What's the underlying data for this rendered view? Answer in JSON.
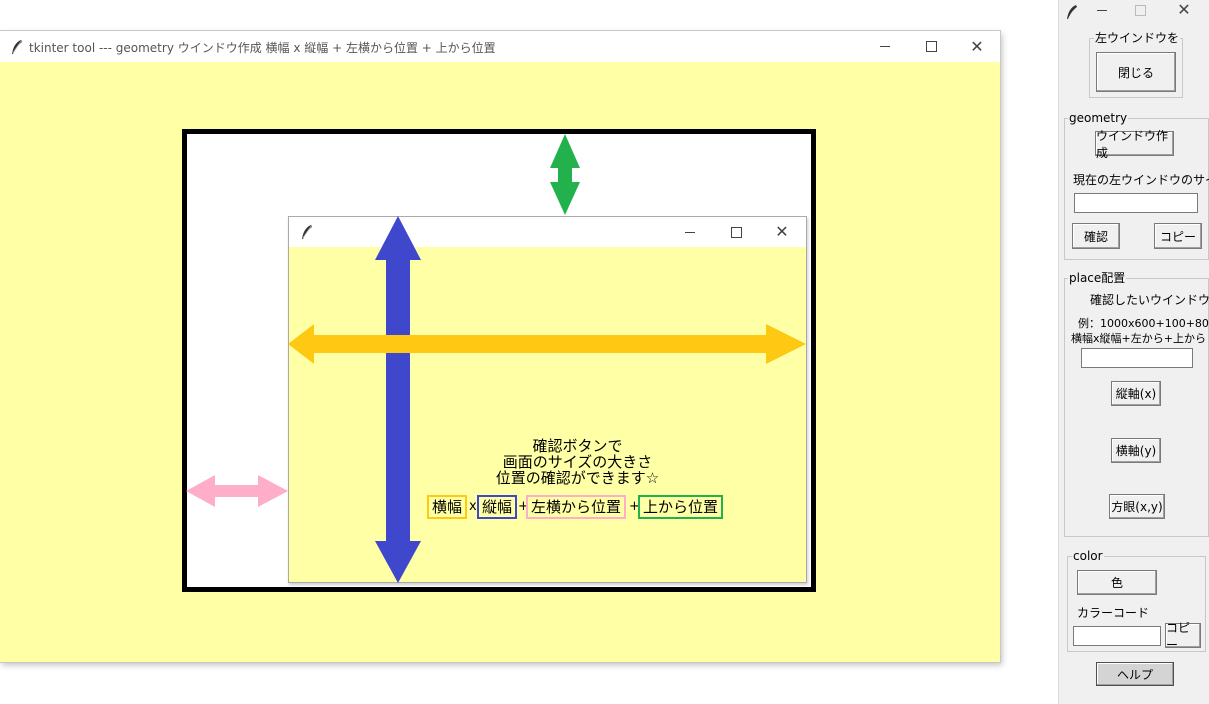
{
  "main_window": {
    "title": "tkinter tool  --- geometry  ウインドウ作成   横幅 x 縦幅 + 左横から位置 + 上から位置"
  },
  "diagram": {
    "explain_lines": [
      "確認ボタンで",
      "画面のサイズの大きさ",
      "位置の確認ができます☆"
    ],
    "legend": {
      "width": "横幅",
      "x_sep": "x",
      "height": "縦幅",
      "plus1": "+",
      "left": "左横から位置",
      "plus2": "+",
      "top": "上から位置"
    },
    "colors": {
      "width_arrow": "#ffc913",
      "height_arrow": "#3f48cc",
      "left_arrow": "#ffaec9",
      "top_arrow": "#22b14c",
      "frame": "#000000",
      "window_bg": "#ffffa6"
    }
  },
  "panel": {
    "close_group": {
      "label": "左ウインドウを",
      "button": "閉じる"
    },
    "geometry_group": {
      "label": "geometry",
      "create_button": "ウインドウ作成",
      "size_label": "現在の左ウインドウのサイズ",
      "size_value": "",
      "confirm_button": "確認",
      "copy_button": "コピー"
    },
    "place_group": {
      "label": "place配置",
      "target_label": "確認したいウインドウ",
      "example_line": "例：1000x600+100+80",
      "format_line": "横幅x縦幅+左から+上から",
      "input_value": "",
      "vertical_button": "縦軸(x)",
      "horizontal_button": "横軸(y)",
      "grid_button": "方眼(x,y)"
    },
    "color_group": {
      "label": "color",
      "color_button": "色",
      "code_label": "カラーコード",
      "code_value": "",
      "copy_button": "コピー"
    },
    "help_button": "ヘルプ"
  }
}
